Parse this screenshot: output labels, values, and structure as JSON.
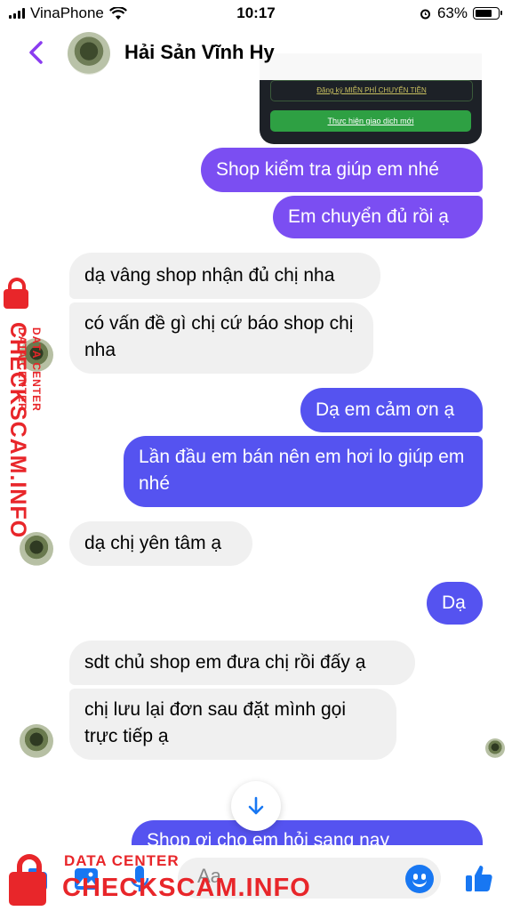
{
  "status_bar": {
    "carrier": "VinaPhone",
    "time": "10:17",
    "battery": "63%"
  },
  "header": {
    "contact_name": "Hải Sản Vĩnh Hy"
  },
  "image_card": {
    "register_link": "Đăng ký MIỄN PHÍ CHUYỂN TIỀN",
    "new_transaction_button": "Thực hiện giao dịch mới"
  },
  "messages": [
    {
      "from": "me",
      "text": "Shop kiểm tra giúp em nhé"
    },
    {
      "from": "me",
      "text": "Em chuyển đủ rồi ạ"
    },
    {
      "from": "shop",
      "text": "dạ vâng shop nhận đủ chị nha"
    },
    {
      "from": "shop",
      "text": "có vấn đề gì chị cứ báo shop chị nha"
    },
    {
      "from": "me",
      "text": "Dạ em cảm ơn ạ"
    },
    {
      "from": "me",
      "text": "Lần đầu em bán nên em hơi lo giúp em nhé"
    },
    {
      "from": "shop",
      "text": "dạ chị yên tâm ạ"
    },
    {
      "from": "me",
      "text": "Dạ"
    },
    {
      "from": "shop",
      "text": "sdt chủ shop em đưa chị rồi đấy ạ"
    },
    {
      "from": "shop",
      "text": "chị lưu lại đơn sau đặt mình gọi trực tiếp ạ"
    },
    {
      "from": "me",
      "text": "Shop ơi cho em hỏi sang nay"
    }
  ],
  "composer": {
    "placeholder": "Aa"
  },
  "watermark": {
    "small": "DATA CENTER",
    "big": "CHECKSCAM.INFO"
  },
  "colors": {
    "outgoing_purple": "#7b4ef2",
    "outgoing_blue": "#5553f0",
    "incoming": "#f0f0f0",
    "accent": "#1877f2",
    "watermark": "#e8262a"
  },
  "icons": [
    "back-chevron-icon",
    "camera-icon",
    "gallery-icon",
    "microphone-icon",
    "emoji-icon",
    "thumbs-up-icon",
    "arrow-down-icon"
  ]
}
